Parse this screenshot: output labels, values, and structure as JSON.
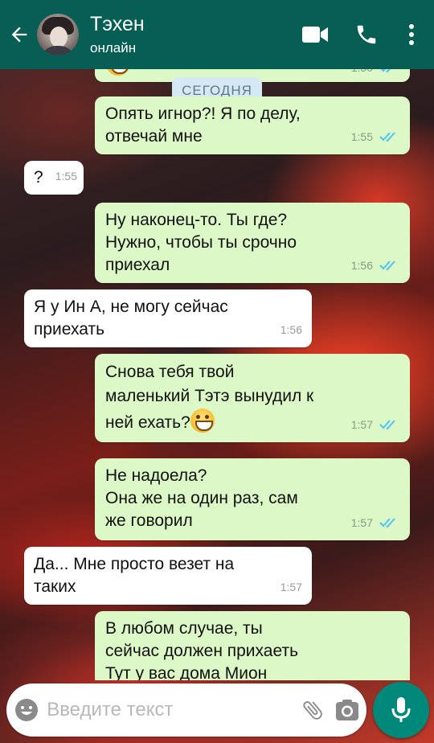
{
  "header": {
    "contact_name": "Тэхен",
    "status": "онлайн"
  },
  "chat": {
    "date_chip": "СЕГОДНЯ",
    "partial_top_time": "1:50",
    "messages": [
      {
        "direction": "out",
        "text": "Опять игнор?! Я по делу,\nотвечай мне",
        "time": "1:55",
        "read": true
      },
      {
        "direction": "in",
        "text": "?",
        "time": "1:55"
      },
      {
        "direction": "out",
        "text": "Ну наконец-то. Ты где?\nНужно, чтобы ты срочно\nприехал",
        "time": "1:56",
        "read": true
      },
      {
        "direction": "in",
        "text": "Я у Ин А, не могу сейчас\nприехать",
        "time": "1:56"
      },
      {
        "direction": "out",
        "text": "Снова тебя твой\nмаленький Тэтэ вынудил к\nней ехать?",
        "emoji": "grinning-face",
        "time": "1:57",
        "read": true
      },
      {
        "direction": "out",
        "text": "Не надоела?\nОна же на один раз, сам\nже говорил",
        "time": "1:57",
        "read": true
      },
      {
        "direction": "in",
        "text": "Да... Мне просто везет на\nтаких",
        "time": "1:57"
      },
      {
        "direction": "out",
        "text": "В любом случае, ты\nсейчас должен прихаеть\nТут у вас дома Мион",
        "time": "",
        "read": false
      }
    ]
  },
  "composer": {
    "placeholder": "Введите текст",
    "value": ""
  },
  "colors": {
    "header": "#075e54",
    "outgoing_bubble": "#dcf8c6",
    "incoming_bubble": "#ffffff",
    "read_ticks": "#4fc3f7",
    "mic_button": "#00897b",
    "date_chip": "#d4e9f4"
  },
  "icons": [
    "back-arrow-icon",
    "video-call-icon",
    "phone-icon",
    "more-vert-icon",
    "emoji-icon",
    "attach-icon",
    "camera-icon",
    "mic-icon"
  ]
}
